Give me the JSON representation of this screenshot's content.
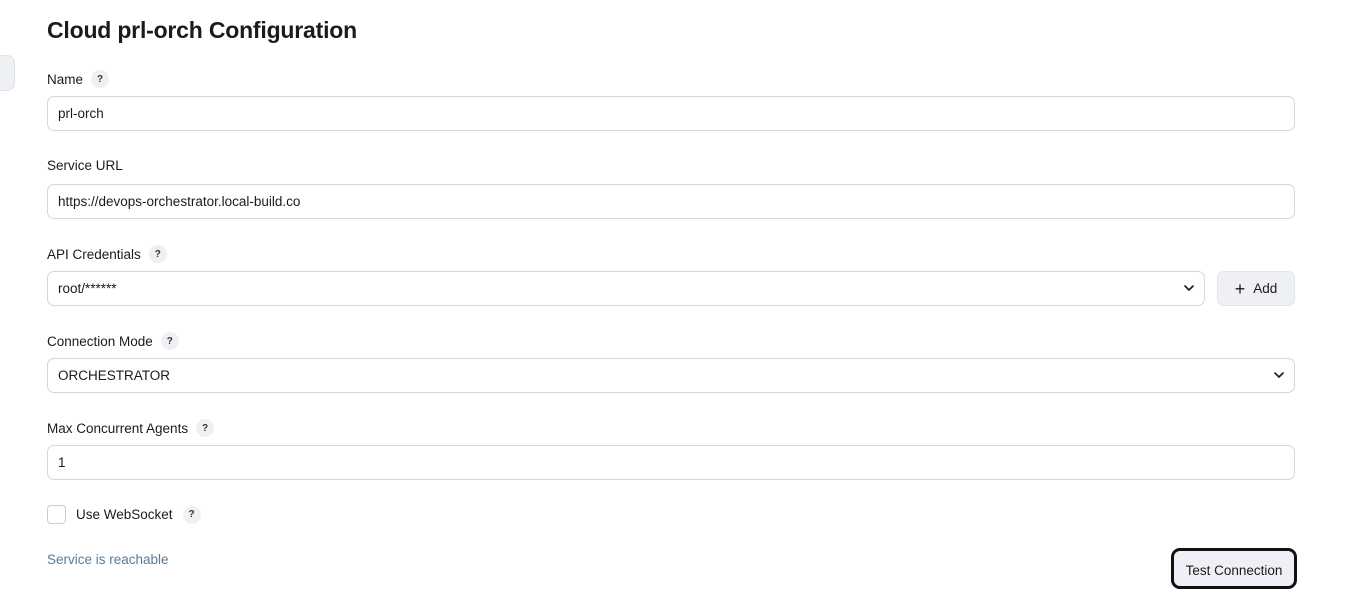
{
  "page": {
    "title": "Cloud prl-orch Configuration"
  },
  "form": {
    "name": {
      "label": "Name",
      "help": "?",
      "value": "prl-orch"
    },
    "service_url": {
      "label": "Service URL",
      "value": "https://devops-orchestrator.local-build.co"
    },
    "api_credentials": {
      "label": "API Credentials",
      "help": "?",
      "selected": "root/******",
      "add_label": "Add"
    },
    "connection_mode": {
      "label": "Connection Mode",
      "help": "?",
      "selected": "ORCHESTRATOR"
    },
    "max_agents": {
      "label": "Max Concurrent Agents",
      "help": "?",
      "value": "1"
    },
    "websocket": {
      "label": "Use WebSocket",
      "help": "?",
      "checked": false
    }
  },
  "status": {
    "text": "Service is reachable",
    "color": "#5a7a98"
  },
  "actions": {
    "test_connection_label": "Test Connection"
  },
  "icons": {
    "help": "question-icon",
    "dropdown": "chevron-down-icon",
    "add": "plus-icon"
  }
}
